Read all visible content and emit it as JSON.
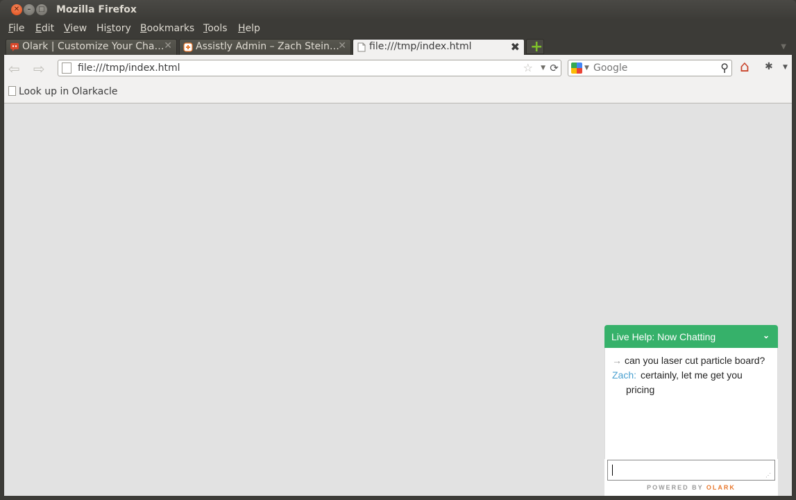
{
  "window": {
    "title": "Mozilla Firefox"
  },
  "menu": [
    {
      "label": "File",
      "accel": "F",
      "rest": "ile"
    },
    {
      "label": "Edit",
      "accel": "E",
      "rest": "dit"
    },
    {
      "label": "View",
      "accel": "V",
      "rest": "iew"
    },
    {
      "label": "History",
      "accel": "s",
      "pre": "Hi",
      "rest": "tory"
    },
    {
      "label": "Bookmarks",
      "accel": "B",
      "rest": "ookmarks"
    },
    {
      "label": "Tools",
      "accel": "T",
      "rest": "ools"
    },
    {
      "label": "Help",
      "accel": "H",
      "rest": "elp"
    }
  ],
  "tabs": [
    {
      "label": "Olark | Customize Your Cha…",
      "icon": "olark-favicon",
      "active": false
    },
    {
      "label": "Assistly Admin – Zach Stein…",
      "icon": "assistly-favicon",
      "active": false
    },
    {
      "label": "file:///tmp/index.html",
      "icon": "page-icon",
      "active": true
    }
  ],
  "navbar": {
    "url": "file:///tmp/index.html",
    "search_placeholder": "Google"
  },
  "bookmarks": [
    {
      "label": "Look up in Olarkacle"
    }
  ],
  "chat": {
    "header": "Live Help: Now Chatting",
    "messages": [
      {
        "from": "",
        "text": "can you laser cut particle board?"
      },
      {
        "from": "Zach:",
        "text_line1": "certainly, let me get you",
        "text_line2": "pricing"
      }
    ],
    "powered_prefix": "POWERED BY",
    "powered_brand": "OLARK"
  },
  "colors": {
    "chat_accent": "#36b16a",
    "olark_brand": "#e8772c",
    "agent_name": "#4aa0d0"
  }
}
